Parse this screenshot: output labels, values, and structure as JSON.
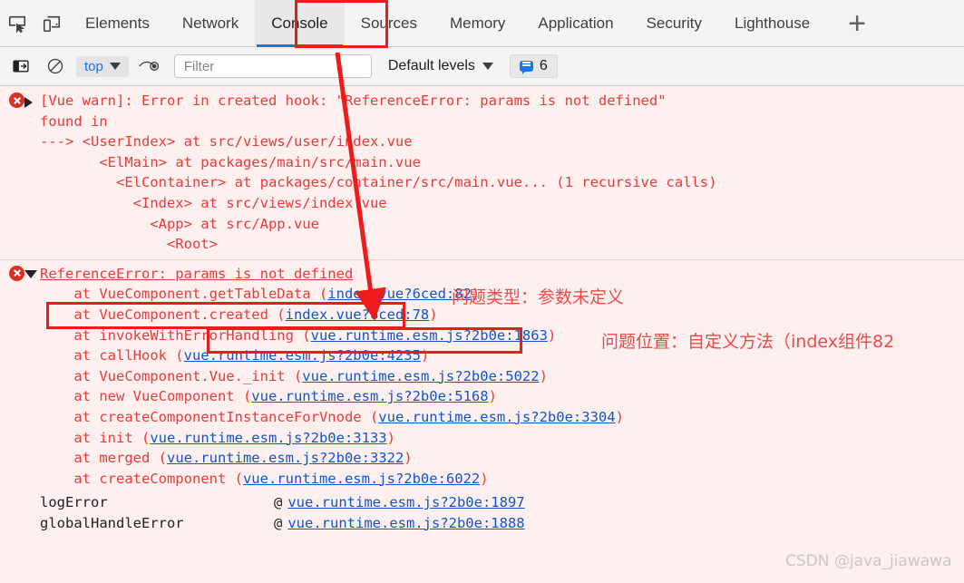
{
  "devtools": {
    "left_icons": [
      {
        "name": "inspect-element-icon",
        "title": "Inspect element"
      },
      {
        "name": "device-toolbar-icon",
        "title": "Toggle device toolbar"
      }
    ],
    "tabs": [
      {
        "label": "Elements",
        "selected": false
      },
      {
        "label": "Network",
        "selected": false
      },
      {
        "label": "Console",
        "selected": true
      },
      {
        "label": "Sources",
        "selected": false
      },
      {
        "label": "Memory",
        "selected": false
      },
      {
        "label": "Application",
        "selected": false
      },
      {
        "label": "Security",
        "selected": false
      },
      {
        "label": "Lighthouse",
        "selected": false
      }
    ],
    "more_tabs_label": "+",
    "toolbar": {
      "sidebar_icon": "show-console-sidebar-icon",
      "clear_icon": "clear-console-icon",
      "context_value": "top",
      "eye_icon": "live-expression-icon",
      "filter_placeholder": "Filter",
      "filter_value": "",
      "levels_label": "Default levels",
      "message_count": "6"
    }
  },
  "console": {
    "group1": {
      "header": "[Vue warn]: Error in created hook: \"ReferenceError: params is not defined\"",
      "lines": [
        "",
        "found in",
        "",
        "---> <UserIndex> at src/views/user/index.vue",
        "       <ElMain> at packages/main/src/main.vue",
        "         <ElContainer> at packages/container/src/main.vue... (1 recursive calls)",
        "           <Index> at src/views/index.vue",
        "             <App> at src/App.vue",
        "               <Root>"
      ]
    },
    "group2": {
      "header": "ReferenceError: params is not defined",
      "frames": [
        {
          "prefix": "    at VueComponent.getTableData (",
          "link": "index.vue?6ced:82",
          "suffix": ")"
        },
        {
          "prefix": "    at VueComponent.created (",
          "link": "index.vue?6ced:78",
          "suffix": ")"
        },
        {
          "prefix": "    at invokeWithErrorHandling (",
          "link": "vue.runtime.esm.js?2b0e:1863",
          "suffix": ")"
        },
        {
          "prefix": "    at callHook (",
          "link": "vue.runtime.esm.js?2b0e:4235",
          "suffix": ")"
        },
        {
          "prefix": "    at VueComponent.Vue._init (",
          "link": "vue.runtime.esm.js?2b0e:5022",
          "suffix": ")"
        },
        {
          "prefix": "    at new VueComponent (",
          "link": "vue.runtime.esm.js?2b0e:5168",
          "suffix": ")"
        },
        {
          "prefix": "    at createComponentInstanceForVnode (",
          "link": "vue.runtime.esm.js?2b0e:3304",
          "suffix": ")"
        },
        {
          "prefix": "    at init (",
          "link": "vue.runtime.esm.js?2b0e:3133",
          "suffix": ")"
        },
        {
          "prefix": "    at merged (",
          "link": "vue.runtime.esm.js?2b0e:3322",
          "suffix": ")"
        },
        {
          "prefix": "    at createComponent (",
          "link": "vue.runtime.esm.js?2b0e:6022",
          "suffix": ")"
        }
      ],
      "at_frames": [
        {
          "fn": "logError",
          "at": "@",
          "link": "vue.runtime.esm.js?2b0e:1897"
        },
        {
          "fn": "globalHandleError",
          "at": "@",
          "link": "vue.runtime.esm.js?2b0e:1888"
        }
      ]
    }
  },
  "annotations": {
    "problem_type": "问题类型：参数未定义",
    "problem_location": "问题位置：自定义方法（index组件82",
    "accent_color": "#ee1b1b"
  },
  "watermark": "CSDN @java_jiawawa"
}
